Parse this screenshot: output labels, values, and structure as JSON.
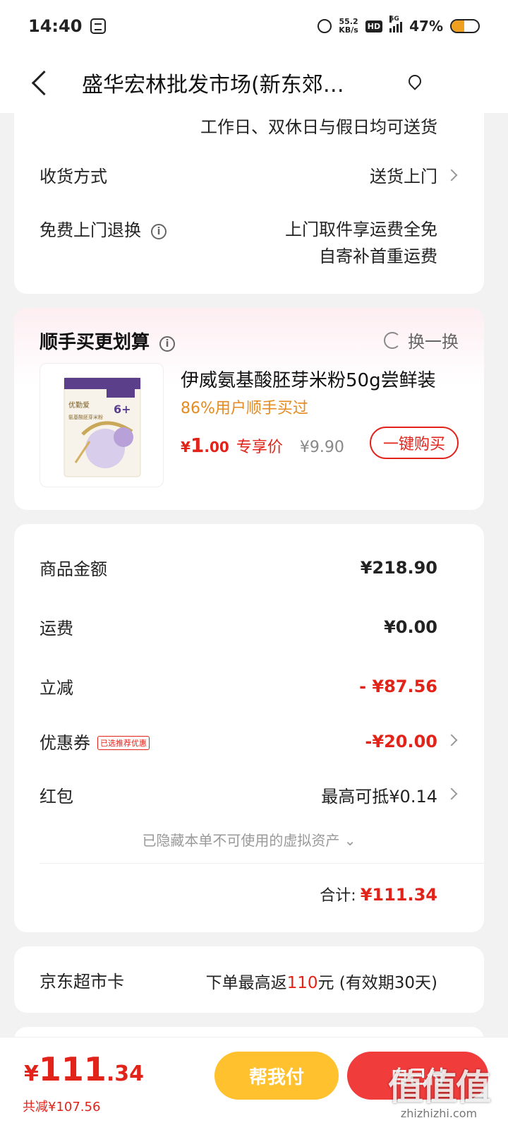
{
  "status_bar": {
    "time": "14:40",
    "net_speed_value": "55.2",
    "net_speed_unit": "KB/s",
    "hd": "HD",
    "network": "5G",
    "battery": "47%",
    "battery_level": 0.47
  },
  "header": {
    "title": "盛华宏林批发市场(新东郊…"
  },
  "delivery": {
    "days_note": "工作日、双休日与假日均可送货",
    "method_label": "收货方式",
    "method_value": "送货上门",
    "return_label": "免费上门退换",
    "return_value_1": "上门取件享运费全免",
    "return_value_2": "自寄补首重运费"
  },
  "upsell": {
    "title": "顺手买更划算",
    "swap_label": "换一换",
    "product_name": "伊威氨基酸胚芽米粉50g尝鲜装",
    "social_proof": "86%用户顺手买过",
    "price_symbol": "¥",
    "price_int": "1",
    "price_dec": ".00",
    "price_tag": "专享价",
    "original_price": "¥9.90",
    "buy_button": "一键购买",
    "package_brand": "优勤爱",
    "package_age": "6+",
    "package_desc": "氨基酸胚芽米粉"
  },
  "summary": {
    "goods_label": "商品金额",
    "goods_value": "¥218.90",
    "shipping_label": "运费",
    "shipping_value": "¥0.00",
    "discount_label": "立减",
    "discount_value": "- ¥87.56",
    "coupon_label": "优惠券",
    "coupon_badge": "已选推荐优惠",
    "coupon_value": "-¥20.00",
    "redpacket_label": "红包",
    "redpacket_value": "最高可抵¥0.14",
    "hidden_assets": "已隐藏本单不可使用的虚拟资产 ⌄",
    "total_label": "合计:",
    "total_value": "¥111.34"
  },
  "supermarket_card": {
    "label": "京东超市卡",
    "value_prefix": "下单最高返",
    "value_amount": "110",
    "value_suffix": "元 (有效期30天)"
  },
  "bottom_bar": {
    "currency": "¥",
    "total_int": "111",
    "total_dec": ".34",
    "saved": "共减¥107.56",
    "help_pay": "帮我付",
    "submit": "自己付"
  },
  "watermark": {
    "logo": "值值值",
    "url": "zhizhizhi.com"
  },
  "colors": {
    "accent_red": "#e2231a",
    "orange": "#e58a1f",
    "yellow_button": "#ffc22e",
    "red_button": "#f13c3c"
  }
}
